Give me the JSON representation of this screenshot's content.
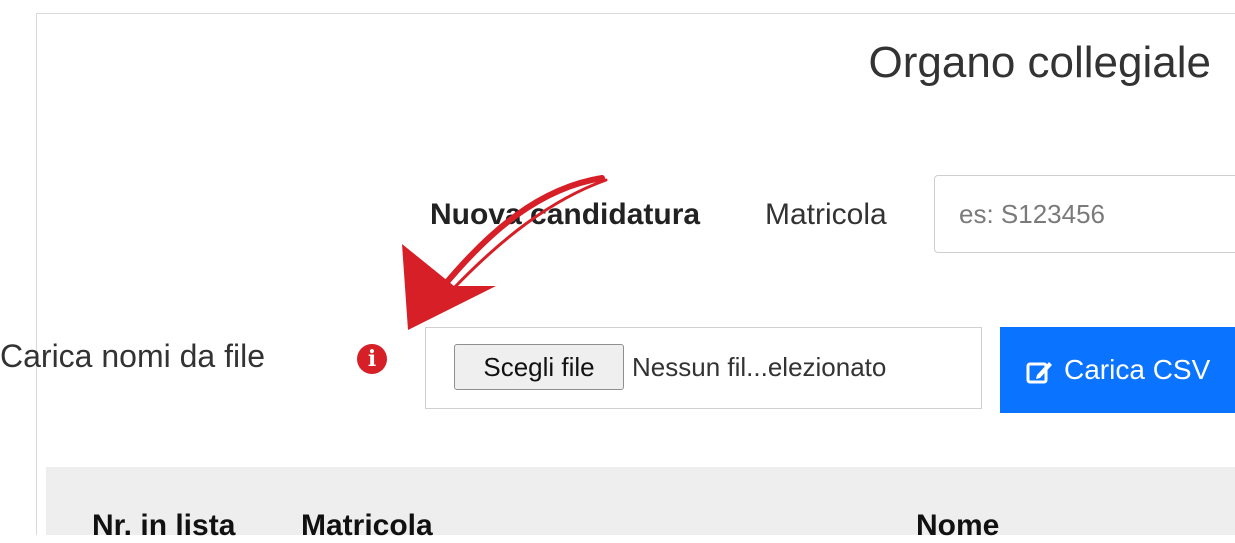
{
  "header": {
    "title": "Organo collegiale"
  },
  "new_candidate": {
    "label": "Nuova candidatura",
    "matricola_label": "Matricola",
    "matricola_placeholder": "es: S123456",
    "matricola_value": ""
  },
  "upload": {
    "label": "Carica nomi da file",
    "info_icon": "info-circle-icon",
    "choose_file_label": "Scegli file",
    "no_file_text": "Nessun fil...elezionato",
    "csv_button_label": "Carica CSV",
    "csv_button_icon": "edit-icon"
  },
  "table": {
    "columns": [
      "Nr. in lista",
      "Matricola",
      "Nome"
    ]
  },
  "colors": {
    "accent": "#0a73ff",
    "info_icon": "#d61f26",
    "annotation_arrow": "#d61f26",
    "table_header_bg": "#eeeeee"
  }
}
